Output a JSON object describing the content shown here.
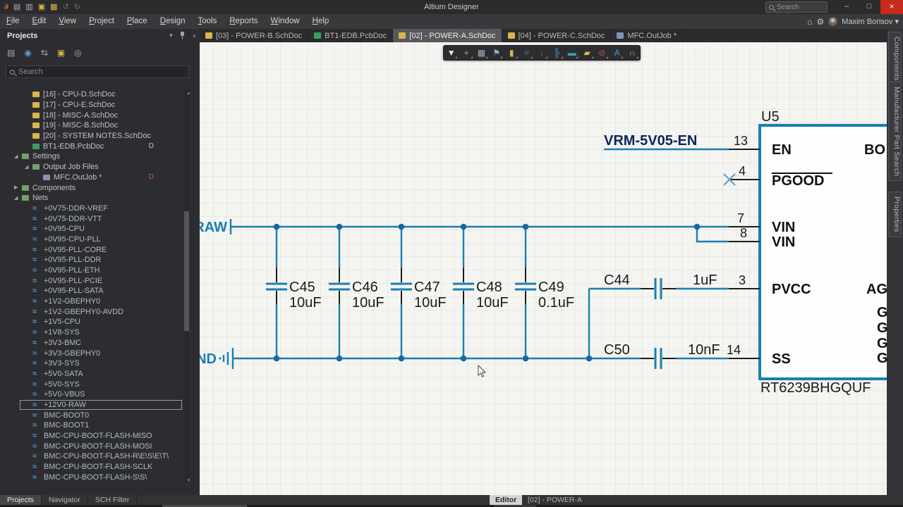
{
  "window": {
    "title": "Altium Designer",
    "search_placeholder": "Search",
    "controls": {
      "minimize": "–",
      "restore": "□",
      "close": "×"
    }
  },
  "quick_access": [
    {
      "name": "altium-logo",
      "glyph": "∂",
      "color": "#e8882f"
    },
    {
      "name": "save",
      "glyph": "▤",
      "color": "#a8b4bc"
    },
    {
      "name": "save-all",
      "glyph": "▥",
      "color": "#a8b4bc"
    },
    {
      "name": "open",
      "glyph": "▣",
      "color": "#d9b648"
    },
    {
      "name": "open-all",
      "glyph": "▩",
      "color": "#d9b648"
    },
    {
      "name": "undo",
      "glyph": "↺",
      "color": "#6e6e6e"
    },
    {
      "name": "redo",
      "glyph": "↻",
      "color": "#6e6e6e"
    }
  ],
  "menu": {
    "items": [
      "File",
      "Edit",
      "View",
      "Project",
      "Place",
      "Design",
      "Tools",
      "Reports",
      "Window",
      "Help"
    ]
  },
  "account": {
    "name": "Maxim Borisov",
    "caret": "▾",
    "home_glyph": "⌂",
    "gear_glyph": "⚙"
  },
  "doc_tabs": [
    {
      "label": "[03] - POWER-B.SchDoc",
      "icon": "schdoc",
      "active": false
    },
    {
      "label": "BT1-EDB.PcbDoc",
      "icon": "pcbdoc",
      "active": false
    },
    {
      "label": "[02] - POWER-A.SchDoc",
      "icon": "schdoc",
      "active": true
    },
    {
      "label": "[04] - POWER-C.SchDoc",
      "icon": "schdoc",
      "active": false
    },
    {
      "label": "MFC.OutJob *",
      "icon": "outjob",
      "active": false
    }
  ],
  "projects_panel": {
    "title": "Projects",
    "search_placeholder": "Search",
    "toolbar": [
      {
        "name": "storage",
        "glyph": "▤",
        "color": "#9db0ba"
      },
      {
        "name": "explorer",
        "glyph": "◉",
        "color": "#5b9bd5"
      },
      {
        "name": "compare",
        "glyph": "⇆",
        "color": "#9db0ba"
      },
      {
        "name": "open-folder",
        "glyph": "▣",
        "color": "#d9b648"
      },
      {
        "name": "settings",
        "glyph": "◎",
        "color": "#9db0ba"
      }
    ],
    "tree": [
      {
        "label": "[16] - CPU-D.SchDoc",
        "icon": "schdoc",
        "indent": 2
      },
      {
        "label": "[17] - CPU-E.SchDoc",
        "icon": "schdoc",
        "indent": 2
      },
      {
        "label": "[18] - MISC-A.SchDoc",
        "icon": "schdoc",
        "indent": 2
      },
      {
        "label": "[19] - MISC-B.SchDoc",
        "icon": "schdoc",
        "indent": 2
      },
      {
        "label": "[20] - SYSTEM NOTES.SchDoc",
        "icon": "schdoc",
        "indent": 2
      },
      {
        "label": "BT1-EDB.PcbDoc",
        "icon": "pcbdoc",
        "indent": 2,
        "badge": "D",
        "badge_color": "#c8c8c8"
      },
      {
        "label": "Settings",
        "icon": "folder",
        "indent": 1,
        "state": "expanded"
      },
      {
        "label": "Output Job Files",
        "icon": "folder",
        "indent": 2,
        "state": "expanded"
      },
      {
        "label": "MFC.OutJob *",
        "icon": "outjob",
        "indent": 3,
        "badge": "D",
        "badge_color": "#c05a50"
      },
      {
        "label": "Components",
        "icon": "folder",
        "indent": 1,
        "state": "collapsed"
      },
      {
        "label": "Nets",
        "icon": "folder",
        "indent": 1,
        "state": "expanded"
      },
      {
        "label": "+0V75-DDR-VREF",
        "icon": "net",
        "indent": 2
      },
      {
        "label": "+0V75-DDR-VTT",
        "icon": "net",
        "indent": 2
      },
      {
        "label": "+0V95-CPU",
        "icon": "net",
        "indent": 2
      },
      {
        "label": "+0V95-CPU-PLL",
        "icon": "net",
        "indent": 2
      },
      {
        "label": "+0V95-PLL-CORE",
        "icon": "net",
        "indent": 2
      },
      {
        "label": "+0V95-PLL-DDR",
        "icon": "net",
        "indent": 2
      },
      {
        "label": "+0V95-PLL-ETH",
        "icon": "net",
        "indent": 2
      },
      {
        "label": "+0V95-PLL-PCIE",
        "icon": "net",
        "indent": 2
      },
      {
        "label": "+0V95-PLL-SATA",
        "icon": "net",
        "indent": 2
      },
      {
        "label": "+1V2-GBEPHY0",
        "icon": "net",
        "indent": 2
      },
      {
        "label": "+1V2-GBEPHY0-AVDD",
        "icon": "net",
        "indent": 2
      },
      {
        "label": "+1V5-CPU",
        "icon": "net",
        "indent": 2
      },
      {
        "label": "+1V8-SYS",
        "icon": "net",
        "indent": 2
      },
      {
        "label": "+3V3-BMC",
        "icon": "net",
        "indent": 2
      },
      {
        "label": "+3V3-GBEPHY0",
        "icon": "net",
        "indent": 2
      },
      {
        "label": "+3V3-SYS",
        "icon": "net",
        "indent": 2
      },
      {
        "label": "+5V0-SATA",
        "icon": "net",
        "indent": 2
      },
      {
        "label": "+5V0-SYS",
        "icon": "net",
        "indent": 2
      },
      {
        "label": "+5V0-VBUS",
        "icon": "net",
        "indent": 2
      },
      {
        "label": "+12V0-RAW",
        "icon": "net",
        "indent": 2,
        "selected": true
      },
      {
        "label": "BMC-BOOT0",
        "icon": "net",
        "indent": 2
      },
      {
        "label": "BMC-BOOT1",
        "icon": "net",
        "indent": 2
      },
      {
        "label": "BMC-CPU-BOOT-FLASH-MISO",
        "icon": "net",
        "indent": 2
      },
      {
        "label": "BMC-CPU-BOOT-FLASH-MOSI",
        "icon": "net",
        "indent": 2
      },
      {
        "label": "BMC-CPU-BOOT-FLASH-R\\E\\S\\E\\T\\",
        "icon": "net",
        "indent": 2
      },
      {
        "label": "BMC-CPU-BOOT-FLASH-SCLK",
        "icon": "net",
        "indent": 2
      },
      {
        "label": "BMC-CPU-BOOT-FLASH-S\\S\\",
        "icon": "net",
        "indent": 2
      }
    ],
    "bottom_tabs": [
      "Projects",
      "Navigator",
      "SCH Filter"
    ]
  },
  "active_bar": {
    "tools": [
      {
        "name": "filter",
        "glyph": "▼",
        "color": "#e8e8e8"
      },
      {
        "name": "move",
        "glyph": "+",
        "color": "#9db0ba"
      },
      {
        "name": "selection-area",
        "glyph": "▦",
        "color": "#9db0ba"
      },
      {
        "name": "placement-flag",
        "glyph": "⚑",
        "color": "#9db0ba"
      },
      {
        "name": "part",
        "glyph": "▮",
        "color": "#d9b648"
      },
      {
        "name": "wire",
        "glyph": "≈",
        "color": "#4f94cf"
      },
      {
        "name": "power-port",
        "glyph": "↓",
        "color": "#c0504d"
      },
      {
        "name": "bus",
        "glyph": "╠",
        "color": "#4f94cf"
      },
      {
        "name": "sheet",
        "glyph": "▬",
        "color": "#3aa3a3"
      },
      {
        "name": "label",
        "glyph": "▰",
        "color": "#d9b648"
      },
      {
        "name": "no-erc",
        "glyph": "⊘",
        "color": "#c0504d"
      },
      {
        "name": "text",
        "glyph": "A",
        "color": "#4f94cf"
      },
      {
        "name": "arc",
        "glyph": "∩",
        "color": "#9db0ba"
      }
    ]
  },
  "right_tabs": [
    "Components",
    "Manufacturer Part Search",
    "Properties"
  ],
  "status_bar": {
    "editor_label": "Editor",
    "doc_label": "[02] - POWER-A"
  },
  "schematic": {
    "colors": {
      "wire": "#1a7fae",
      "net_label": "#0d2458",
      "pin": "#1c1c1c"
    },
    "power_ports": {
      "top_rail_label": "RAW",
      "bottom_rail_label": "ND"
    },
    "net_label": "VRM-5V05-EN",
    "component": {
      "designator": "U5",
      "part_number": "RT6239BHGQUF",
      "left_pins": [
        {
          "number": "13",
          "name": "EN"
        },
        {
          "number": "4",
          "name": "PGOOD",
          "overline": true,
          "no_connect": true
        },
        {
          "number": "7",
          "name": "VIN"
        },
        {
          "number": "8",
          "name": "VIN"
        },
        {
          "number": "3",
          "name": "PVCC"
        },
        {
          "number": "14",
          "name": "SS"
        }
      ],
      "right_pins_visible": [
        "BO",
        "AG",
        "G",
        "G",
        "G",
        "G"
      ]
    },
    "shunt_capacitors": [
      {
        "ref": "C45",
        "value": "10uF"
      },
      {
        "ref": "C46",
        "value": "10uF"
      },
      {
        "ref": "C47",
        "value": "10uF"
      },
      {
        "ref": "C48",
        "value": "10uF"
      },
      {
        "ref": "C49",
        "value": "0.1uF"
      }
    ],
    "series_capacitors": [
      {
        "ref": "C44",
        "value": "1uF",
        "pin": "3"
      },
      {
        "ref": "C50",
        "value": "10nF",
        "pin": "14"
      }
    ]
  }
}
